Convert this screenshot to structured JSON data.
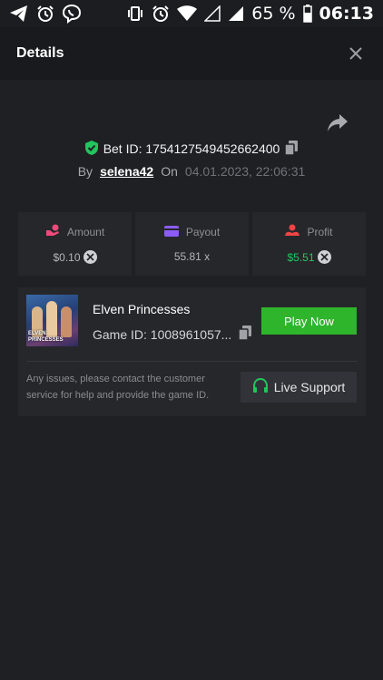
{
  "status_bar": {
    "battery": "65 %",
    "time": "06:13",
    "icons": [
      "telegram-icon",
      "alarm-icon",
      "viber-icon",
      "vibrate-icon",
      "alarm-icon",
      "wifi-icon",
      "signal-icon",
      "signal-icon",
      "battery-icon"
    ]
  },
  "header": {
    "title": "Details"
  },
  "bet": {
    "id_label": "Bet ID: 1754127549452662400",
    "by_label": "By",
    "username": "selena42",
    "on_label": "On",
    "date": "04.01.2023, 22:06:31"
  },
  "stats": [
    {
      "label": "Amount",
      "value": "$0.10",
      "icon": "amount-icon",
      "color": "#ef4a7a"
    },
    {
      "label": "Payout",
      "value": "55.81 x",
      "icon": "payout-card-icon",
      "color": "#8b5cf6"
    },
    {
      "label": "Profit",
      "value": "$5.51",
      "icon": "profit-icon",
      "color": "#ef4444"
    }
  ],
  "game": {
    "thumbnail_text": "ELVEN PRINCESSES",
    "name": "Elven Princesses",
    "game_id": "Game ID: 1008961057...",
    "play_label": "Play Now",
    "support_text": "Any issues, please contact the customer service for help and provide the game ID.",
    "support_label": "Live Support"
  },
  "colors": {
    "accent_green": "#2fb52c",
    "background": "#1f2024",
    "card": "#26272b"
  }
}
